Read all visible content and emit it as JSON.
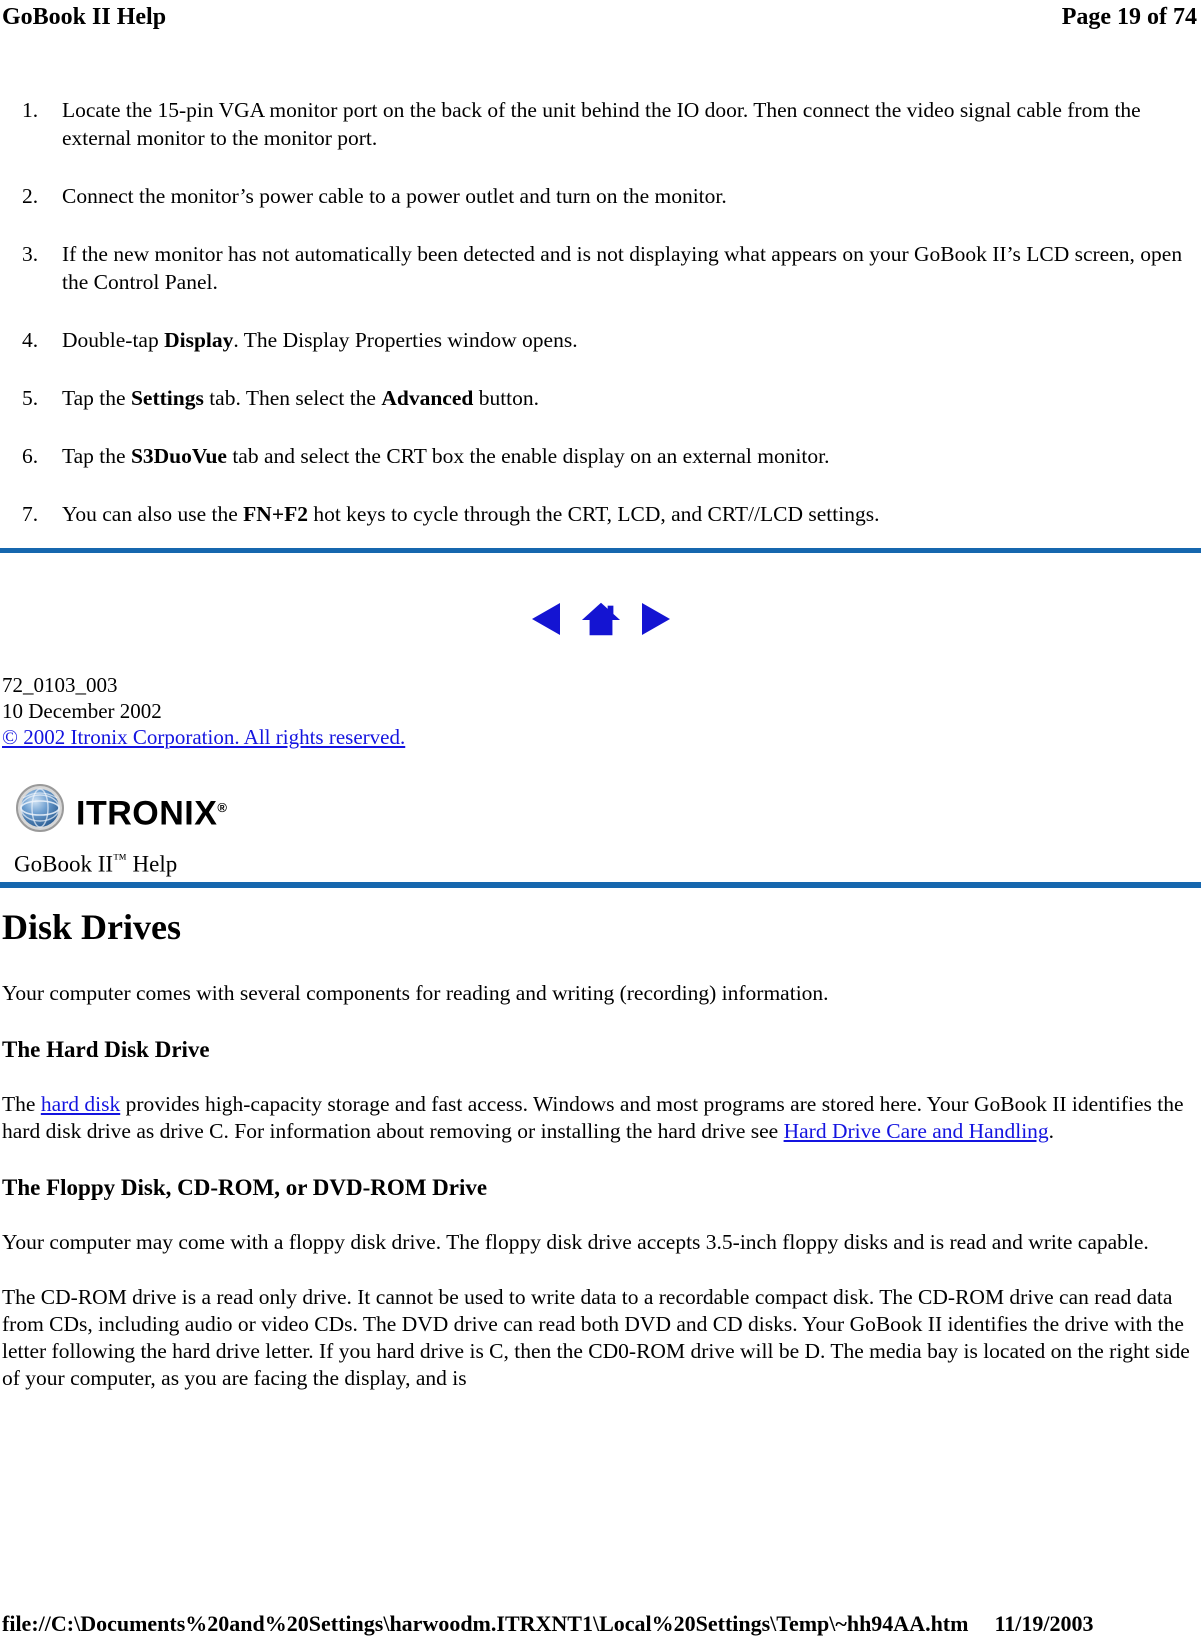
{
  "header": {
    "left_title": "GoBook II Help",
    "page_label": "Page 19 of 74"
  },
  "steps": [
    {
      "num": "1.",
      "parts": [
        {
          "t": "Locate the 15-pin VGA monitor port on the back of the unit behind the IO door. Then connect the video signal cable from the external monitor to the monitor port.",
          "b": false
        }
      ]
    },
    {
      "num": "2.",
      "parts": [
        {
          "t": "Connect the monitor’s power cable to a power outlet and turn on the monitor.",
          "b": false
        }
      ]
    },
    {
      "num": "3.",
      "parts": [
        {
          "t": "If the new monitor has not automatically been detected and is not displaying what appears on your GoBook II’s LCD screen, open the Control Panel.",
          "b": false
        }
      ]
    },
    {
      "num": "4.",
      "parts": [
        {
          "t": "Double-tap ",
          "b": false
        },
        {
          "t": "Display",
          "b": true
        },
        {
          "t": ". The Display Properties window opens.",
          "b": false
        }
      ]
    },
    {
      "num": "5.",
      "parts": [
        {
          "t": "Tap the ",
          "b": false
        },
        {
          "t": "Settings",
          "b": true
        },
        {
          "t": " tab. Then select the ",
          "b": false
        },
        {
          "t": "Advanced",
          "b": true
        },
        {
          "t": " button.",
          "b": false
        }
      ]
    },
    {
      "num": "6.",
      "parts": [
        {
          "t": "Tap the ",
          "b": false
        },
        {
          "t": "S3DuoVue",
          "b": true
        },
        {
          "t": " tab and select the CRT box the enable display on an external monitor.",
          "b": false
        }
      ]
    },
    {
      "num": "7.",
      "parts": [
        {
          "t": "You can also use the ",
          "b": false
        },
        {
          "t": "FN+F2",
          "b": true
        },
        {
          "t": " hot keys to cycle through the CRT, LCD, and CRT//LCD settings.",
          "b": false
        }
      ]
    }
  ],
  "nav": {
    "back_icon": "left-triangle-icon",
    "home_icon": "house-icon",
    "forward_icon": "right-triangle-icon",
    "icon_color": "#1414D2"
  },
  "doc_meta": {
    "doc_number": "72_0103_003",
    "doc_date": "10 December 2002",
    "copyright": "© 2002 Itronix Corporation.  All rights reserved."
  },
  "branding": {
    "logo_word": "ITRONIX",
    "logo_mark": "®",
    "globe_icon": "globe-icon",
    "help_title": "GoBook II",
    "help_tm": "™",
    "help_suffix": " Help"
  },
  "article": {
    "title": "Disk Drives",
    "intro": "Your computer comes with several components for reading and writing (recording) information.",
    "section1_heading": "The Hard Disk Drive",
    "section1_p1_a": "The ",
    "section1_link1": "hard disk",
    "section1_p1_b": " provides high-capacity storage and fast access. Windows and most programs are stored here. Your GoBook II identifies the hard disk drive as drive C.  For information about removing or installing the hard drive see ",
    "section1_link2": "Hard Drive Care and Handling",
    "section1_p1_c": ".",
    "section2_heading": "The Floppy Disk, CD-ROM, or DVD-ROM Drive",
    "section2_p1": "Your computer may come with a floppy disk drive.  The floppy disk drive accepts 3.5-inch floppy disks and is read and write capable.",
    "section2_p2": "The CD-ROM drive is a read only drive.  It cannot be used to write data to a recordable compact disk.  The CD-ROM drive can read data from CDs, including audio or video CDs.  The DVD drive can read both DVD and CD disks.  Your GoBook II identifies the drive with the letter following the hard drive letter.  If you hard drive is C, then the CD0-ROM drive will be D.  The media bay is located on the right side of your computer, as you are facing the display, and is"
  },
  "footer": {
    "file_path": "file://C:\\Documents%20and%20Settings\\harwoodm.ITRXNT1\\Local%20Settings\\Temp\\~hh94AA.htm",
    "date": "11/19/2003"
  },
  "colors": {
    "rule_blue": "#1667AE",
    "link_blue": "#1414E0",
    "nav_blue": "#1414D2"
  }
}
